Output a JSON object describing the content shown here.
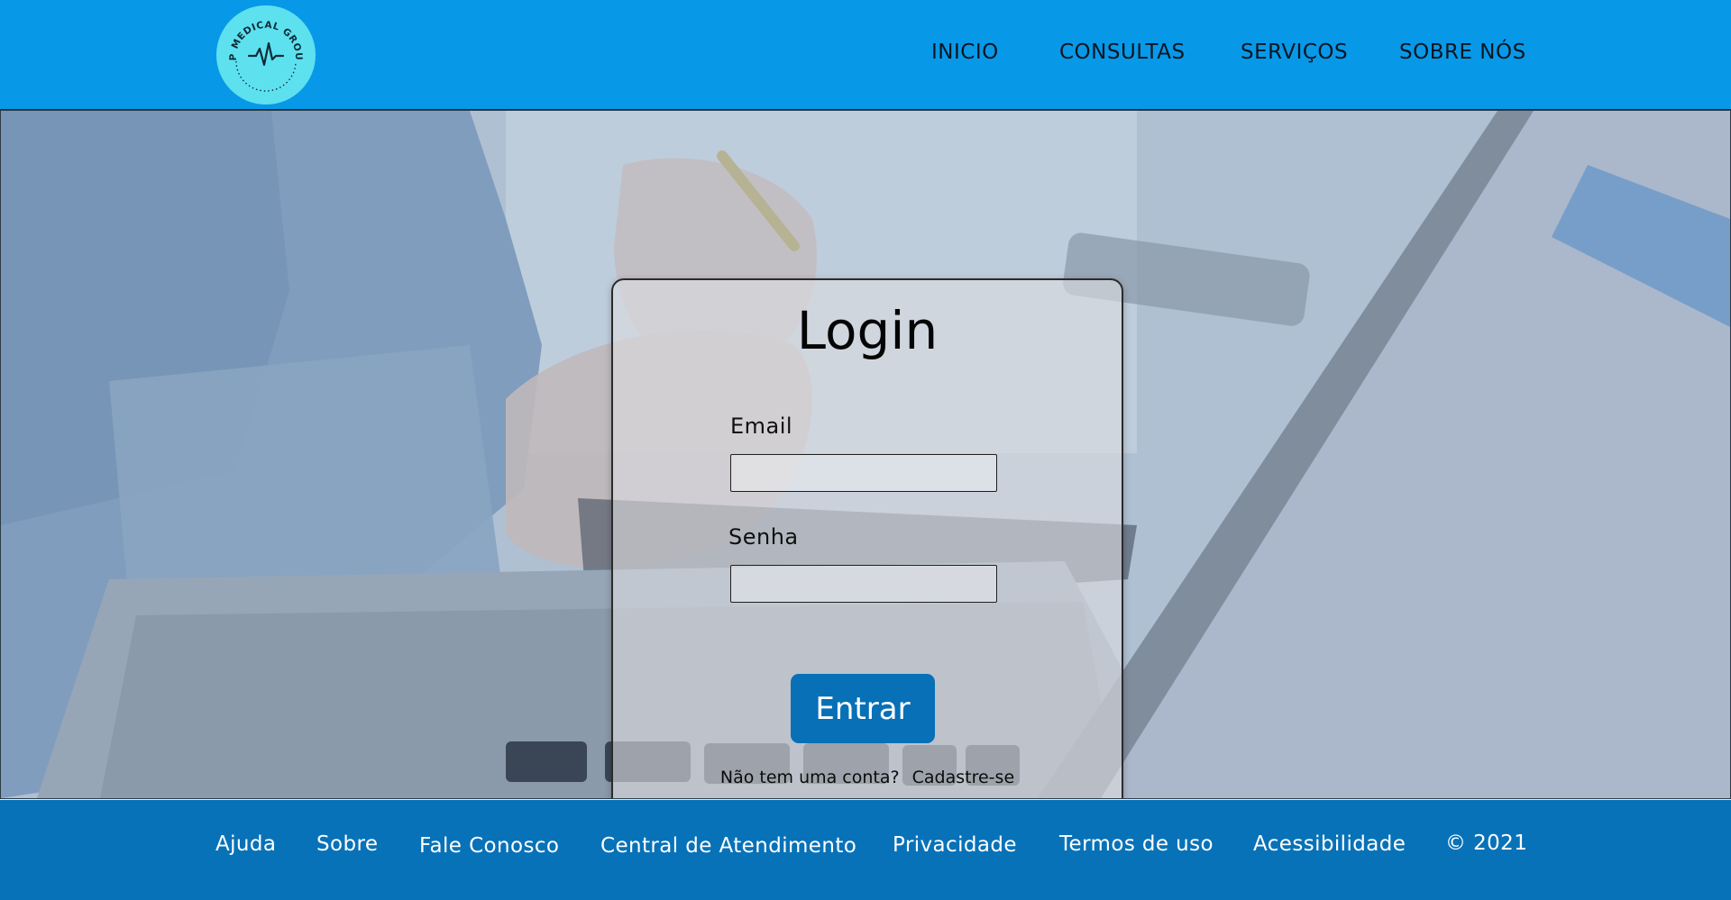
{
  "header": {
    "logo_text": "SP MEDICAL GROUP",
    "nav": [
      "INICIO",
      "CONSULTAS",
      "SERVIÇOS",
      "SOBRE NÓS"
    ]
  },
  "login": {
    "title": "Login",
    "email_label": "Email",
    "email_value": "",
    "password_label": "Senha",
    "password_value": "",
    "submit_label": "Entrar",
    "no_account_text": "Não tem uma conta?",
    "signup_link": "Cadastre-se"
  },
  "footer": {
    "links": [
      "Ajuda",
      "Sobre",
      "Fale Conosco",
      "Central de Atendimento",
      "Privacidade",
      "Termos de uso",
      "Acessibilidade"
    ],
    "copyright": "© 2021"
  },
  "colors": {
    "header_bg": "#0898e8",
    "logo_bg": "#5ee1ee",
    "button_bg": "#0770b7",
    "footer_bg": "#0872b8"
  },
  "icons": {
    "logo": "heartbeat-icon"
  }
}
